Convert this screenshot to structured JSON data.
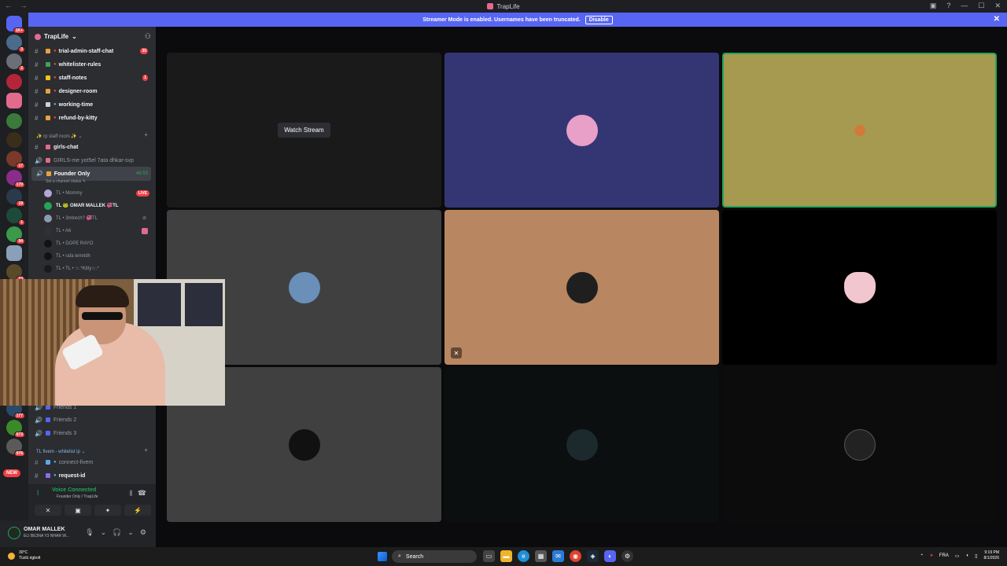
{
  "window": {
    "title": "TrapLife",
    "nav": "← →",
    "controls": [
      "▣",
      "?",
      "—",
      "☐",
      "✕"
    ]
  },
  "banner": {
    "text": "Streamer Mode is enabled. Usernames have been truncated.",
    "button": "Disable",
    "close": "✕"
  },
  "rail": {
    "badges": [
      "1K+",
      "3",
      "2",
      "17",
      "170",
      "19",
      "1",
      "94",
      "23",
      "177",
      "673",
      "976"
    ],
    "new_label": "NEW"
  },
  "server": {
    "name": "TrapLife",
    "chevron": "⌄",
    "add_member_icon": "user-add-icon"
  },
  "channels": [
    {
      "label": "trial-admin-staff-chat",
      "bold": true,
      "count": "30",
      "emoji_color": "#e8a33d",
      "dot_color": "#f23f43"
    },
    {
      "label": "whitelister-rules",
      "bold": true,
      "count": "",
      "emoji_color": "#3ba55d",
      "dot_color": "#f23f43"
    },
    {
      "label": "staff-notes",
      "bold": true,
      "count": "1",
      "emoji_color": "#f0c419",
      "dot_color": "#f23f43"
    },
    {
      "label": "designer-room",
      "bold": true,
      "count": "",
      "emoji_color": "#e8a33d",
      "dot_color": "#f23f43"
    },
    {
      "label": "working-time",
      "bold": true,
      "count": "",
      "emoji_color": "#c9d1db",
      "dot_color": "#5aa9e6"
    },
    {
      "label": "refund-by-kitty",
      "bold": true,
      "count": "",
      "emoji_color": "#e8a33d",
      "dot_color": "#f23f43"
    }
  ],
  "category_staff": "✨ rp staff room ✨ ⌄",
  "channels2": [
    {
      "label": "girls-chat",
      "type": "text",
      "bold": true
    },
    {
      "label": "GIRLS-me yot5el 7ata dhkar-svp",
      "type": "voice",
      "bold": false
    }
  ],
  "voice_channel": {
    "label": "Founder Only",
    "timer": "46:53",
    "status_hint": "Set a channel status ✎"
  },
  "members": [
    {
      "label": "TL • Mommy",
      "live": "LIVE",
      "color": "#b3a6d8",
      "me": false
    },
    {
      "label": "TL 🐸 OMAR MALLEK 💞TL",
      "live": "",
      "color": "#23a55a",
      "me": true
    },
    {
      "label": "TL • 3mlrech? 💞TL",
      "live": "",
      "color": "#8a9bb0",
      "me": false
    },
    {
      "label": "TL • A6",
      "live": "",
      "color": "#2f3136",
      "me": false
    },
    {
      "label": "TL • DOPE RAYO",
      "live": "",
      "color": "#111214",
      "me": false
    },
    {
      "label": "TL • rafa lemridh",
      "live": "",
      "color": "#111214",
      "me": false
    },
    {
      "label": "TL • TL • ☆.*Kitty☆.*",
      "live": "",
      "color": "#1a1a1a",
      "me": false
    }
  ],
  "friends_channels": [
    "Friends 1",
    "Friends 2",
    "Friends 3"
  ],
  "category_fivem": "TL fivem - whitelist ip ⌄",
  "channels3": [
    {
      "label": "connect-fivem",
      "bold": false
    },
    {
      "label": "request-id",
      "bold": true
    }
  ],
  "voice_panel": {
    "status": "Voice Connected",
    "location": "Founder Only / TrapLife",
    "buttons": [
      "✕",
      "▣",
      "✦",
      "⚡"
    ]
  },
  "user": {
    "name": "OMAR MALLEK",
    "status": "ELI BE3NA Y3 NHAR W...",
    "controls": [
      "🎙",
      "⌄",
      "🎧",
      "⌄",
      "⚙"
    ]
  },
  "tiles": [
    {
      "bg": "#1a1a1a",
      "watch_label": "Watch Stream",
      "avatar_color": "",
      "muted": false
    },
    {
      "bg": "#343674",
      "watch_label": "",
      "avatar_color": "#e8a0c8",
      "muted": false
    },
    {
      "bg": "#a59a50",
      "watch_label": "",
      "avatar_color": "#a59a50",
      "muted": false
    },
    {
      "bg": "#404040",
      "watch_label": "",
      "avatar_color": "#6a8fb8",
      "muted": false
    },
    {
      "bg": "#b88660",
      "watch_label": "",
      "avatar_color": "#1f1f1f",
      "muted": true
    },
    {
      "bg": "#000000",
      "watch_label": "",
      "avatar_color": "#f2c6cf",
      "muted": false
    },
    {
      "bg": "#404040",
      "watch_label": "",
      "avatar_color": "#111111",
      "muted": false
    },
    {
      "bg": "#0b0f10",
      "watch_label": "",
      "avatar_color": "#1d2a2d",
      "muted": false
    },
    {
      "bg": "#0c0c0c",
      "watch_label": "",
      "avatar_color": "#222222",
      "muted": false
    }
  ],
  "taskbar": {
    "temperature": "30°C",
    "weather": "Tüzlü égbolt",
    "search": "Search",
    "language": "FRA",
    "time": "9:19 PM",
    "date": "8/1/2026"
  },
  "colors": {
    "accent": "#5865f2",
    "voice_green": "#23a55a",
    "alert_red": "#f23f43"
  }
}
